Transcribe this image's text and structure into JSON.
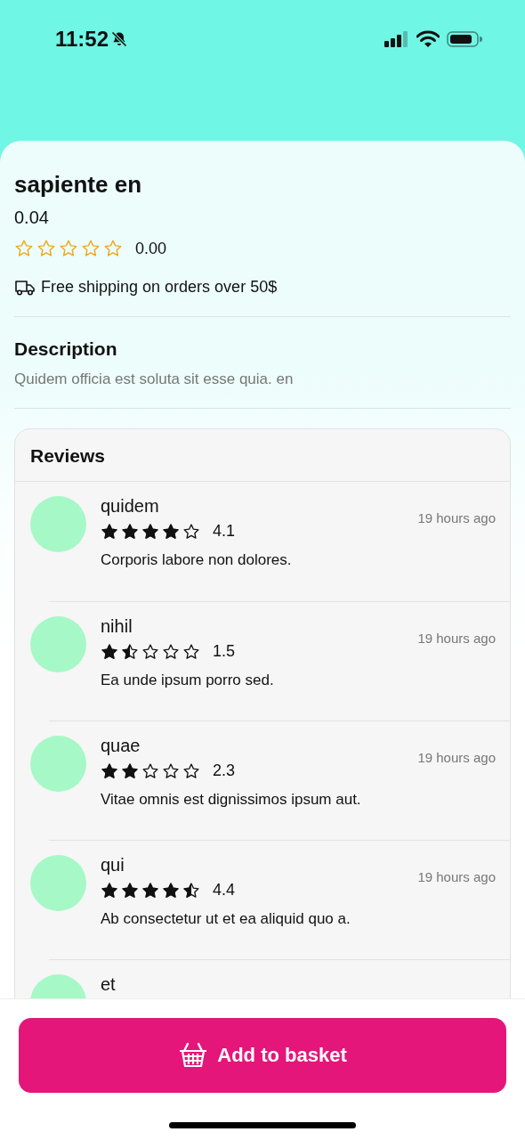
{
  "status_bar": {
    "time": "11:52",
    "muted": true
  },
  "product": {
    "name": "sapiente en",
    "price": "0.04",
    "stars": 0,
    "rating": "0.00",
    "shipping": "Free shipping on orders over 50$"
  },
  "description": {
    "title": "Description",
    "text": "Quidem officia est soluta sit esse quia. en"
  },
  "reviews": {
    "title": "Reviews",
    "items": [
      {
        "name": "quidem",
        "stars": 4,
        "rating": "4.1",
        "text": "Corporis labore non dolores.",
        "time": "19 hours ago"
      },
      {
        "name": "nihil",
        "stars": 1.5,
        "rating": "1.5",
        "text": "Ea unde ipsum porro sed.",
        "time": "19 hours ago"
      },
      {
        "name": "quae",
        "stars": 2,
        "rating": "2.3",
        "text": "Vitae omnis est dignissimos ipsum aut.",
        "time": "19 hours ago"
      },
      {
        "name": "qui",
        "stars": 4.5,
        "rating": "4.4",
        "text": "Ab consectetur ut et ea aliquid quo a.",
        "time": "19 hours ago"
      },
      {
        "name": "et"
      }
    ]
  },
  "footer": {
    "button": "Add to basket"
  }
}
